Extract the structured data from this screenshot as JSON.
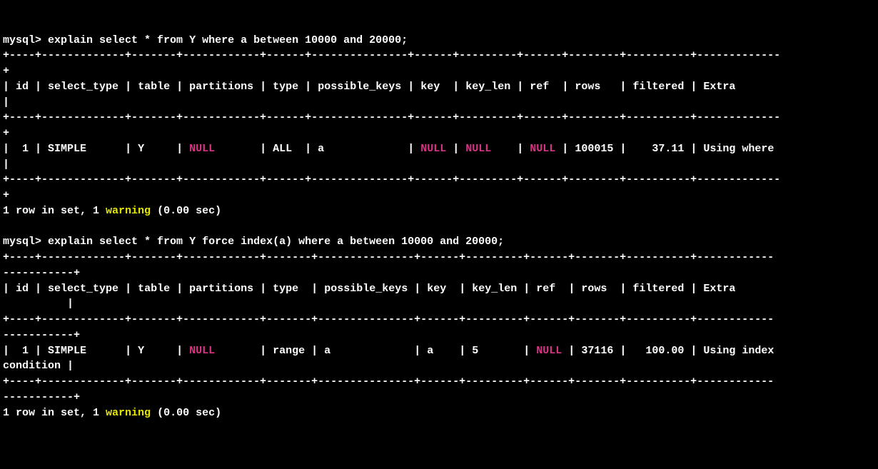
{
  "q1": {
    "prompt": "mysql>",
    "command": "explain select * from Y where a between 10000 and 20000;",
    "bordertop": "+----+-------------+-------+------------+------+---------------+------+---------+------+--------+----------+-------------",
    "borderwrap": "+",
    "headers": {
      "id": "id",
      "select_type": "select_type",
      "table": "table",
      "partitions": "partitions",
      "type": "type",
      "possible_keys": "possible_keys",
      "key": "key",
      "key_len": "key_len",
      "ref": "ref",
      "rows": "rows",
      "filtered": "filtered",
      "Extra": "Extra"
    },
    "row": {
      "id": "1",
      "select_type": "SIMPLE",
      "table": "Y",
      "partitions": "NULL",
      "type": "ALL",
      "possible_keys": "a",
      "key": "NULL",
      "key_len": "NULL",
      "ref": "NULL",
      "rows": "100015",
      "filtered": "37.11",
      "Extra": "Using where"
    },
    "footer_rows": "1 row in set, 1",
    "footer_warn": "warning",
    "footer_time": "(0.00 sec)"
  },
  "q2": {
    "prompt": "mysql>",
    "command": "explain select * from Y force index(a) where a between 10000 and 20000;",
    "bordertop": "+----+-------------+-------+------------+-------+---------------+------+---------+------+-------+----------+------------",
    "borderwrap": "-----------+",
    "headers": {
      "id": "id",
      "select_type": "select_type",
      "table": "table",
      "partitions": "partitions",
      "type": "type",
      "possible_keys": "possible_keys",
      "key": "key",
      "key_len": "key_len",
      "ref": "ref",
      "rows": "rows",
      "filtered": "filtered",
      "Extra": "Extra"
    },
    "row": {
      "id": "1",
      "select_type": "SIMPLE",
      "table": "Y",
      "partitions": "NULL",
      "type": "range",
      "possible_keys": "a",
      "key": "a",
      "key_len": "5",
      "ref": "NULL",
      "rows": "37116",
      "filtered": "100.00",
      "Extra": "Using index"
    },
    "extra_wrap": "condition |",
    "footer_rows": "1 row in set, 1",
    "footer_warn": "warning",
    "footer_time": "(0.00 sec)"
  },
  "chart_data": {
    "type": "table",
    "queries": [
      {
        "sql": "explain select * from Y where a between 10000 and 20000;",
        "columns": [
          "id",
          "select_type",
          "table",
          "partitions",
          "type",
          "possible_keys",
          "key",
          "key_len",
          "ref",
          "rows",
          "filtered",
          "Extra"
        ],
        "rows": [
          {
            "id": 1,
            "select_type": "SIMPLE",
            "table": "Y",
            "partitions": null,
            "type": "ALL",
            "possible_keys": "a",
            "key": null,
            "key_len": null,
            "ref": null,
            "rows": 100015,
            "filtered": 37.11,
            "Extra": "Using where"
          }
        ],
        "status": "1 row in set, 1 warning (0.00 sec)"
      },
      {
        "sql": "explain select * from Y force index(a) where a between 10000 and 20000;",
        "columns": [
          "id",
          "select_type",
          "table",
          "partitions",
          "type",
          "possible_keys",
          "key",
          "key_len",
          "ref",
          "rows",
          "filtered",
          "Extra"
        ],
        "rows": [
          {
            "id": 1,
            "select_type": "SIMPLE",
            "table": "Y",
            "partitions": null,
            "type": "range",
            "possible_keys": "a",
            "key": "a",
            "key_len": 5,
            "ref": null,
            "rows": 37116,
            "filtered": 100.0,
            "Extra": "Using index condition"
          }
        ],
        "status": "1 row in set, 1 warning (0.00 sec)"
      }
    ]
  }
}
